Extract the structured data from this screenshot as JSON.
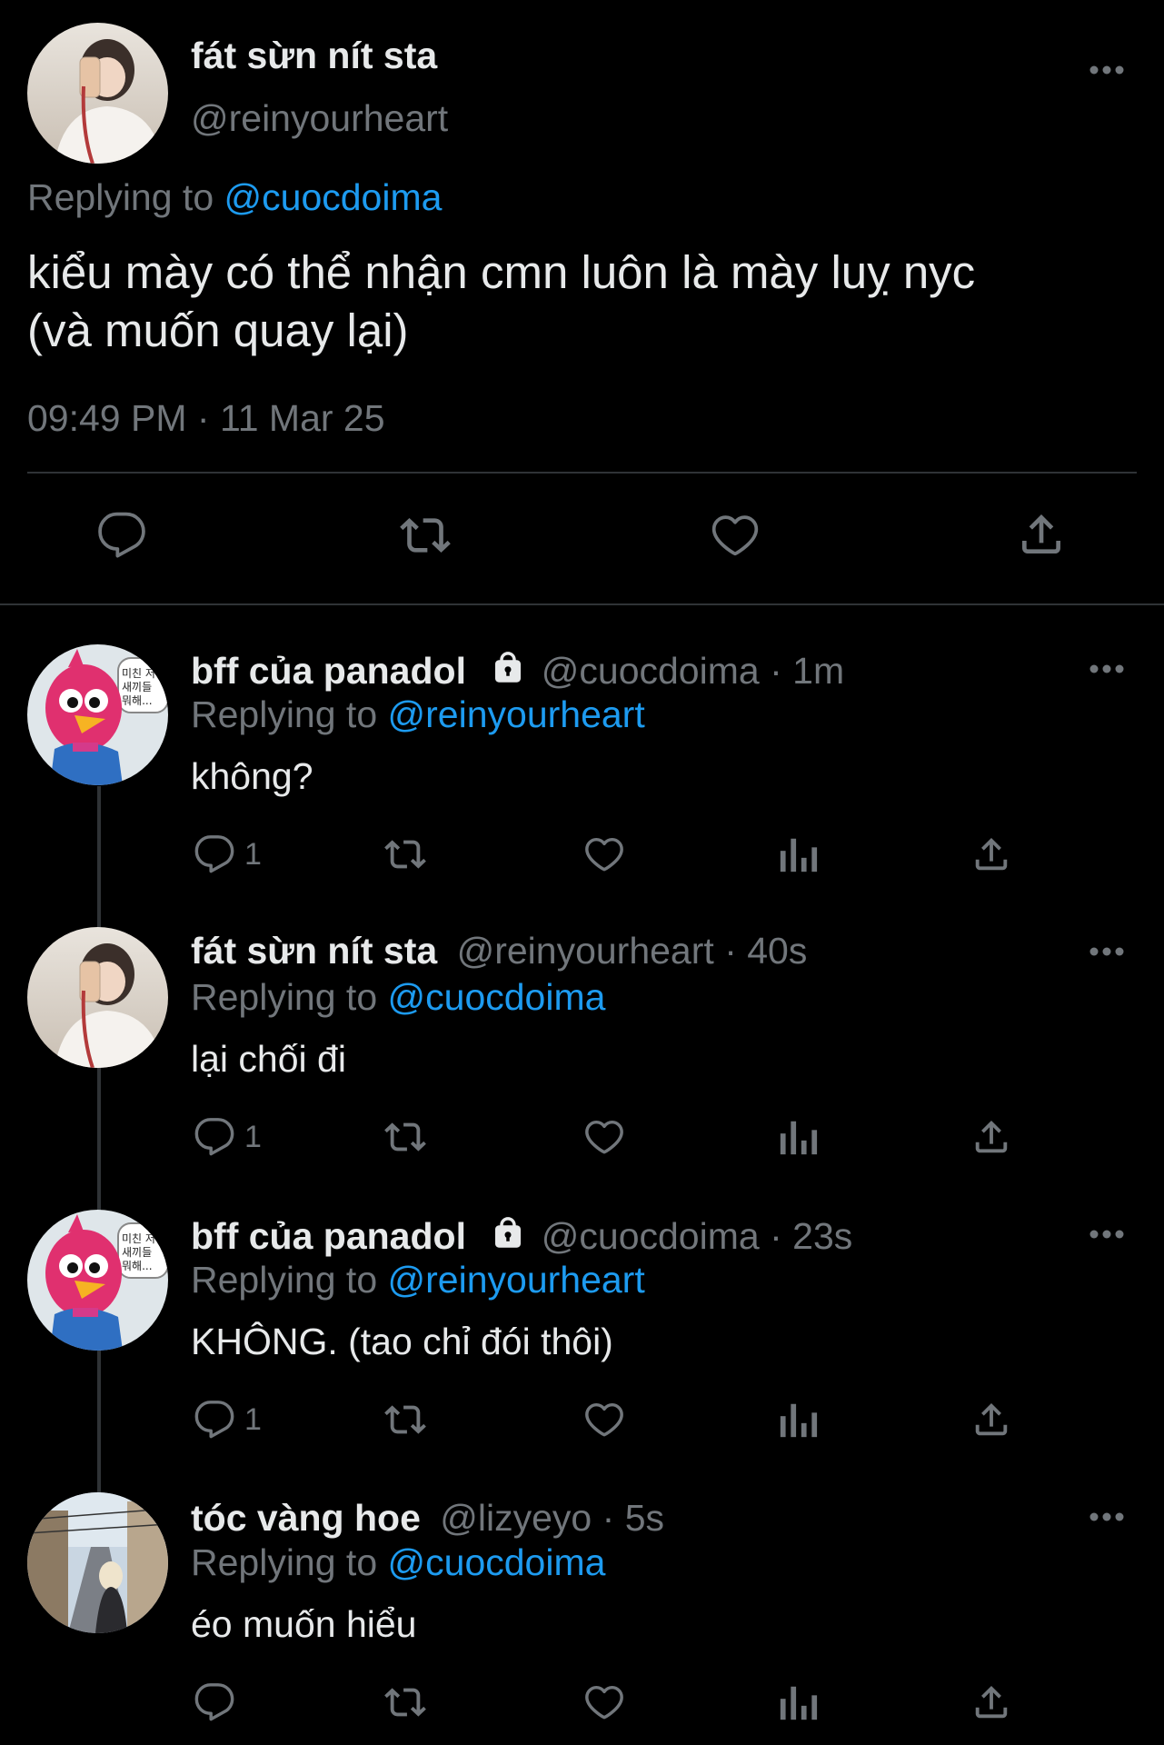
{
  "main_tweet": {
    "display_name": "fát sừn nít sta",
    "handle": "@reinyourheart",
    "replying_label": "Replying to",
    "replying_to": "@cuocdoima",
    "text_line1": "kiểu mày có thể nhận cmn luôn là mày luỵ nyc",
    "text_line2": "(và muốn quay lại)",
    "time": "09:49 PM",
    "sep": "·",
    "date": "11 Mar 25"
  },
  "replies": [
    {
      "display_name": "bff của panadol",
      "locked": true,
      "handle": "@cuocdoima",
      "sep": "·",
      "age": "1m",
      "replying_label": "Replying to",
      "replying_to": "@reinyourheart",
      "text": "không?",
      "reply_count": "1",
      "avatar": "pink-bird-avatar",
      "avatar_bubble": "미친 저 새끼들 뭐해..."
    },
    {
      "display_name": "fát sừn nít sta",
      "locked": false,
      "handle": "@reinyourheart",
      "sep": "·",
      "age": "40s",
      "replying_label": "Replying to",
      "replying_to": "@cuocdoima",
      "text": "lại chối đi",
      "reply_count": "1",
      "avatar": "girl-selfie-avatar"
    },
    {
      "display_name": "bff của panadol",
      "locked": true,
      "handle": "@cuocdoima",
      "sep": "·",
      "age": "23s",
      "replying_label": "Replying to",
      "replying_to": "@reinyourheart",
      "text": "KHÔNG. (tao chỉ đói thôi)",
      "reply_count": "1",
      "avatar": "pink-bird-avatar",
      "avatar_bubble": "미친 저 새끼들 뭐해..."
    },
    {
      "display_name": "tóc vàng hoe",
      "locked": false,
      "handle": "@lizyeyo",
      "sep": "·",
      "age": "5s",
      "replying_label": "Replying to",
      "replying_to": "@cuocdoima",
      "text": "éo muốn hiểu",
      "reply_count": "",
      "avatar": "street-photo-avatar"
    }
  ],
  "icons": [
    "more-icon",
    "reply-icon",
    "retweet-icon",
    "like-icon",
    "share-icon",
    "views-icon",
    "lock-icon"
  ],
  "colors": {
    "background": "#000000",
    "text": "#e7e9ea",
    "secondary": "#71767b",
    "link": "#1d9bf0",
    "divider": "#2f3336"
  }
}
